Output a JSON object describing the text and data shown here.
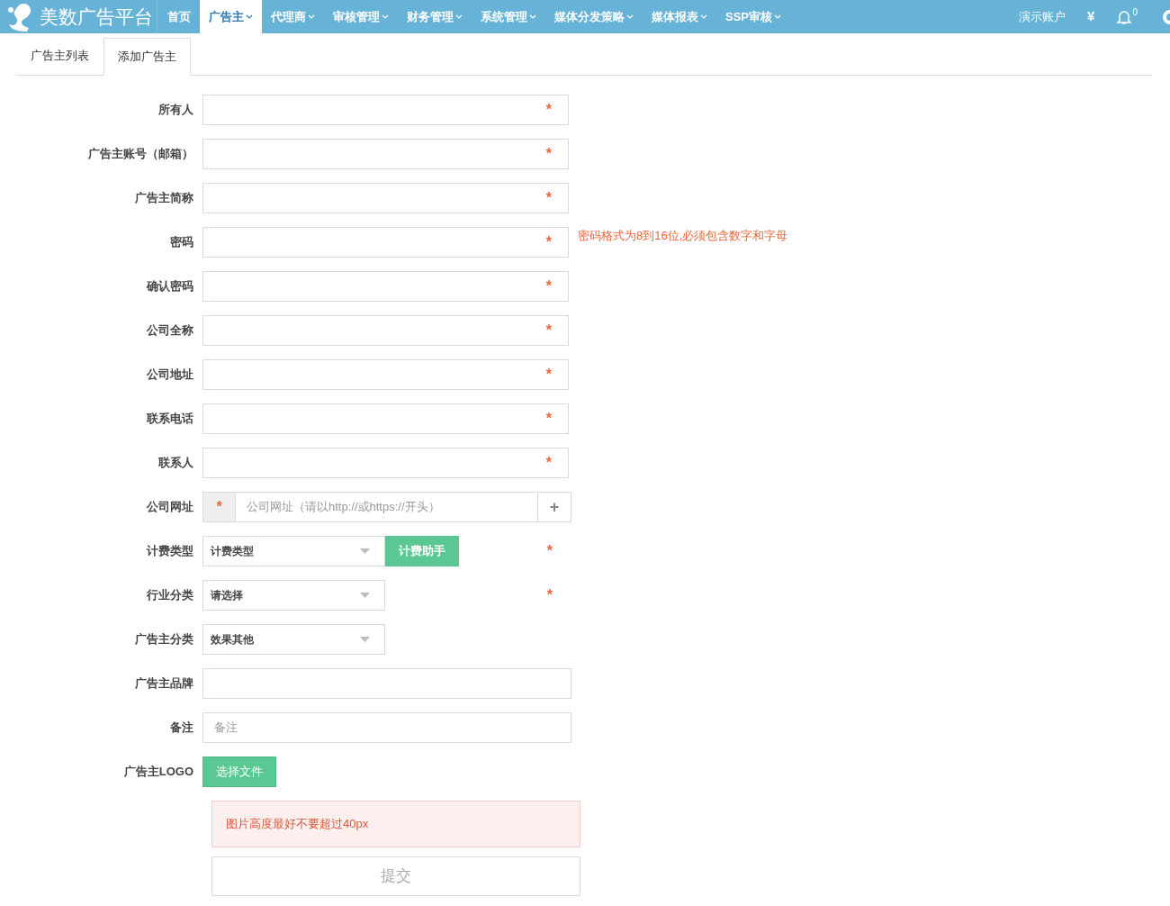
{
  "brand": {
    "name": "美数广告平台"
  },
  "nav": [
    {
      "label": "首页",
      "dropdown": false,
      "selected": false
    },
    {
      "label": "广告主",
      "dropdown": true,
      "selected": true
    },
    {
      "label": "代理商",
      "dropdown": true,
      "selected": false
    },
    {
      "label": "审核管理",
      "dropdown": true,
      "selected": false
    },
    {
      "label": "财务管理",
      "dropdown": true,
      "selected": false
    },
    {
      "label": "系统管理",
      "dropdown": true,
      "selected": false
    },
    {
      "label": "媒体分发策略",
      "dropdown": true,
      "selected": false
    },
    {
      "label": "媒体报表",
      "dropdown": true,
      "selected": false
    },
    {
      "label": "SSP审核",
      "dropdown": true,
      "selected": false
    }
  ],
  "account": {
    "name": "演示账户",
    "currency": "¥",
    "notifications": "0"
  },
  "tabs": [
    {
      "label": "广告主列表",
      "selected": false
    },
    {
      "label": "添加广告主",
      "selected": true
    }
  ],
  "fields": [
    {
      "kind": "text",
      "label": "所有人",
      "required_mark": "*"
    },
    {
      "kind": "text",
      "label": "广告主账号（邮箱）",
      "required_mark": "*"
    },
    {
      "kind": "text",
      "label": "广告主简称",
      "required_mark": "*"
    },
    {
      "kind": "text",
      "label": "密码",
      "required_mark": "*",
      "hint": "密码格式为8到16位,必须包含数字和字母"
    },
    {
      "kind": "text",
      "label": "确认密码",
      "required_mark": "*"
    },
    {
      "kind": "text",
      "label": "公司全称",
      "required_mark": "*"
    },
    {
      "kind": "text",
      "label": "公司地址",
      "required_mark": "*"
    },
    {
      "kind": "text",
      "label": "联系电话",
      "required_mark": "*"
    },
    {
      "kind": "text",
      "label": "联系人",
      "required_mark": "*"
    },
    {
      "kind": "url",
      "label": "公司网址",
      "required_mark": "*",
      "placeholder": "公司网址（请以http://或https://开头）",
      "add": "+"
    },
    {
      "kind": "select",
      "label": "计费类型",
      "value": "计费类型",
      "button": "计费助手",
      "required_mark": "*"
    },
    {
      "kind": "select",
      "label": "行业分类",
      "value": "请选择",
      "required_mark": "*"
    },
    {
      "kind": "select",
      "label": "广告主分类",
      "value": "效果其他"
    },
    {
      "kind": "wide",
      "label": "广告主品牌"
    },
    {
      "kind": "wide",
      "label": "备注",
      "placeholder": "备注"
    },
    {
      "kind": "file",
      "label": "广告主LOGO",
      "button": "选择文件"
    }
  ],
  "notice": "图片高度最好不要超过40px",
  "submit": "提交"
}
